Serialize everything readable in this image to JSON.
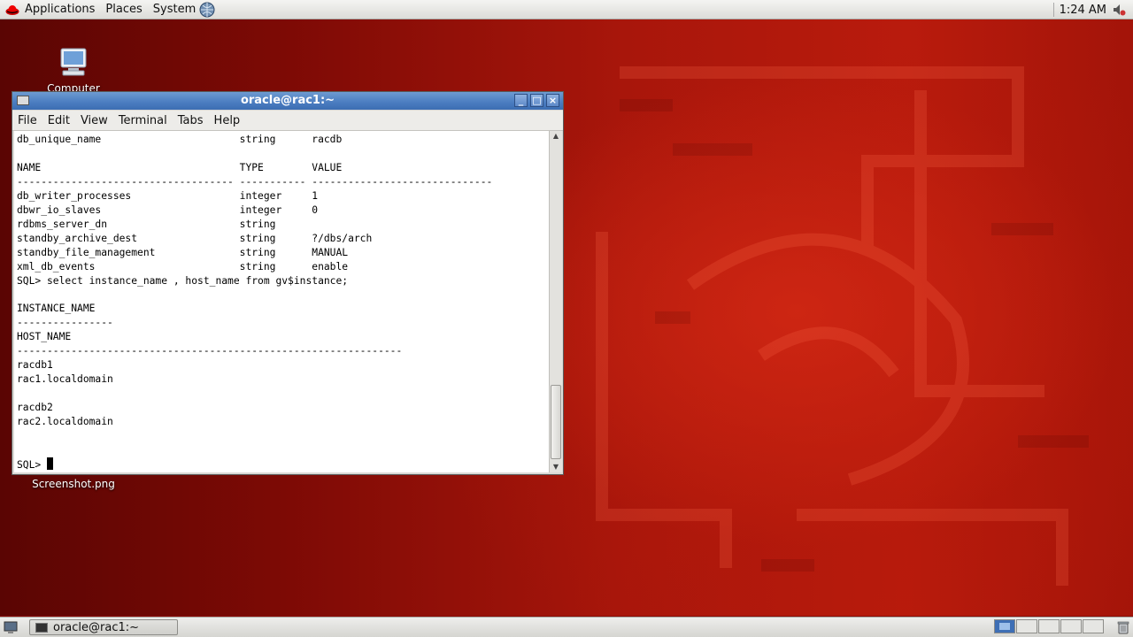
{
  "top_panel": {
    "menus": [
      "Applications",
      "Places",
      "System"
    ],
    "clock": "1:24 AM"
  },
  "desktop": {
    "icons": [
      {
        "label": "Computer"
      },
      {
        "label": "Screenshot.png"
      }
    ]
  },
  "terminal": {
    "title": "oracle@rac1:~",
    "menus": [
      "File",
      "Edit",
      "View",
      "Terminal",
      "Tabs",
      "Help"
    ],
    "lines": [
      "db_unique_name                       string      racdb",
      "",
      "NAME                                 TYPE        VALUE",
      "------------------------------------ ----------- ------------------------------",
      "db_writer_processes                  integer     1",
      "dbwr_io_slaves                       integer     0",
      "rdbms_server_dn                      string",
      "standby_archive_dest                 string      ?/dbs/arch",
      "standby_file_management              string      MANUAL",
      "xml_db_events                        string      enable",
      "SQL> select instance_name , host_name from gv$instance;",
      "",
      "INSTANCE_NAME",
      "----------------",
      "HOST_NAME",
      "----------------------------------------------------------------",
      "racdb1",
      "rac1.localdomain",
      "",
      "racdb2",
      "rac2.localdomain",
      "",
      ""
    ],
    "prompt": "SQL> "
  },
  "bottom_panel": {
    "task_label": "oracle@rac1:~"
  },
  "icons": {
    "distro": "redhat-icon",
    "network": "network-icon",
    "volume": "volume-icon",
    "computer": "computer-icon",
    "trash": "trash-icon",
    "show_desktop": "show-desktop-icon"
  },
  "colors": {
    "title_bar": "#4a7cc0",
    "desktop": "#a8160b"
  }
}
